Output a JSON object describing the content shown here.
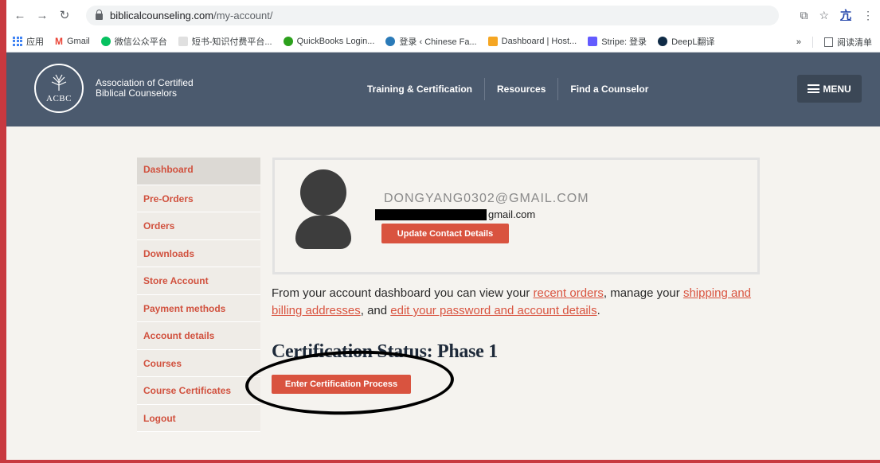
{
  "browser": {
    "url_domain": "biblicalcounseling.com",
    "url_path": "/my-account/",
    "profile_initial": "亢",
    "bookmarks": [
      {
        "label": "应用",
        "icon": "apps-icon"
      },
      {
        "label": "Gmail",
        "icon": "gmail-icon",
        "color": "#ea4335"
      },
      {
        "label": "微信公众平台",
        "icon": "wechat-icon",
        "color": "#07c160"
      },
      {
        "label": "短书-知识付费平台...",
        "icon": "duanshu-icon",
        "color": "#e0e0e0"
      },
      {
        "label": "QuickBooks Login...",
        "icon": "quickbooks-icon",
        "color": "#2ca01c"
      },
      {
        "label": "登录 ‹ Chinese Fa...",
        "icon": "wordpress-icon",
        "color": "#2a7ab8"
      },
      {
        "label": "Dashboard | Host...",
        "icon": "host-icon",
        "color": "#f5a623"
      },
      {
        "label": "Stripe: 登录",
        "icon": "stripe-icon",
        "color": "#635bff"
      },
      {
        "label": "DeepL翻译",
        "icon": "deepl-icon",
        "color": "#0f2b46"
      }
    ],
    "more_label": "»",
    "reading_list": "阅读清单"
  },
  "header": {
    "logo_text": "ACBC",
    "org_line1": "Association of Certified",
    "org_line2": "Biblical Counselors",
    "nav": [
      "Training & Certification",
      "Resources",
      "Find a Counselor"
    ],
    "menu_label": "MENU"
  },
  "sidebar": {
    "items": [
      {
        "label": "Dashboard",
        "active": true
      },
      {
        "label": "Pre-Orders"
      },
      {
        "label": "Orders"
      },
      {
        "label": "Downloads"
      },
      {
        "label": "Store Account"
      },
      {
        "label": "Payment methods"
      },
      {
        "label": "Account details"
      },
      {
        "label": "Courses"
      },
      {
        "label": "Course Certificates"
      },
      {
        "label": "Logout"
      }
    ]
  },
  "profile": {
    "username": "DONGYANG0302@GMAIL.COM",
    "email_suffix": "gmail.com",
    "update_label": "Update Contact Details"
  },
  "dashboard": {
    "intro": "From your account dashboard you can view your ",
    "link_orders": "recent orders",
    "mid1": ", manage your ",
    "link_addresses": "shipping and billing addresses",
    "mid2": ", and ",
    "link_account": "edit your password and account details",
    "end": "."
  },
  "certification": {
    "title": "Certification Status: Phase 1",
    "button_label": "Enter Certification Process"
  },
  "colors": {
    "accent": "#d9533f",
    "header_bg": "#4b5a6e",
    "content_bg": "#f5f3ef"
  }
}
